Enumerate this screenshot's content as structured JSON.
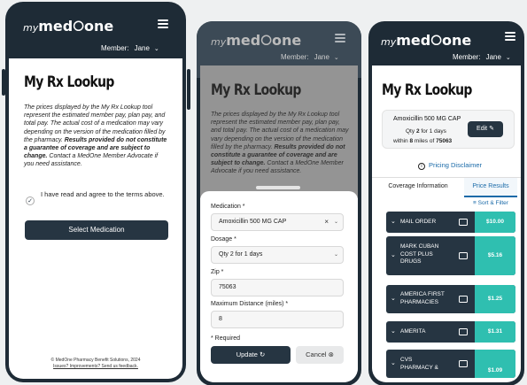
{
  "brand": {
    "logo_prefix": "my",
    "logo_main": "med",
    "logo_suffix": "one",
    "accent": "#2fbfb0",
    "dark": "#263542"
  },
  "header": {
    "member_label": "Member:",
    "member_name": "Jane",
    "menu_icon": "hamburger-icon"
  },
  "page": {
    "title": "My Rx Lookup",
    "disclaimer_text": "The prices displayed by the My Rx Lookup tool represent the estimated member pay, plan pay, and total pay. The actual cost of a medication may vary depending on the version of the medication filled by the pharmacy.",
    "disclaimer_bold": "Results provided do not constitute a guarantee of coverage and are subject to change.",
    "disclaimer_end": "Contact a MedOne Member Advocate if you need assistance."
  },
  "phone1": {
    "agree_text": "I have read and agree to the terms above.",
    "select_button": "Select Medication",
    "footer_copy": "© MedOne Pharmacy Benefit Solutions, 2024",
    "footer_link": "Issues? Improvements? Send us feedback."
  },
  "phone2": {
    "medication_label": "Medication *",
    "medication_value": "Amoxicillin 500 MG CAP",
    "dosage_label": "Dosage *",
    "dosage_value": "Qty 2 for 1 days",
    "zip_label": "Zip *",
    "zip_value": "75063",
    "distance_label": "Maximum Distance (miles) *",
    "distance_value": "8",
    "required_note": "* Required",
    "update_button": "Update",
    "cancel_button": "Cancel"
  },
  "phone3": {
    "card_med": "Amoxicillin 500 MG CAP",
    "card_qty_pre": "Qty",
    "card_qty_num": "2",
    "card_qty_post": "for 1 days",
    "card_within_pre": "within",
    "card_within_num": "8",
    "card_within_mid": "miles of",
    "card_zip": "75063",
    "edit_button": "Edit",
    "pricing_disclaimer": "Pricing Disclaimer",
    "tabs": [
      "Coverage Information",
      "Price Results"
    ],
    "sort_filter": "Sort & Filter",
    "pharmacies": [
      {
        "name": "MAIL ORDER",
        "price": "$10.00",
        "icon": "mail-icon"
      },
      {
        "name": "MARK CUBAN COST PLUS DRUGS",
        "price": "$5.16",
        "icon": "mail-icon"
      },
      {
        "name": "AMERICA FIRST PHARMACIES",
        "price": "$1.25",
        "icon": "store-icon"
      },
      {
        "name": "AMERITA",
        "price": "$1.31",
        "icon": "store-icon"
      },
      {
        "name": "CVS PHARMACY &",
        "price": "$1.09",
        "icon": "store-icon"
      }
    ]
  }
}
